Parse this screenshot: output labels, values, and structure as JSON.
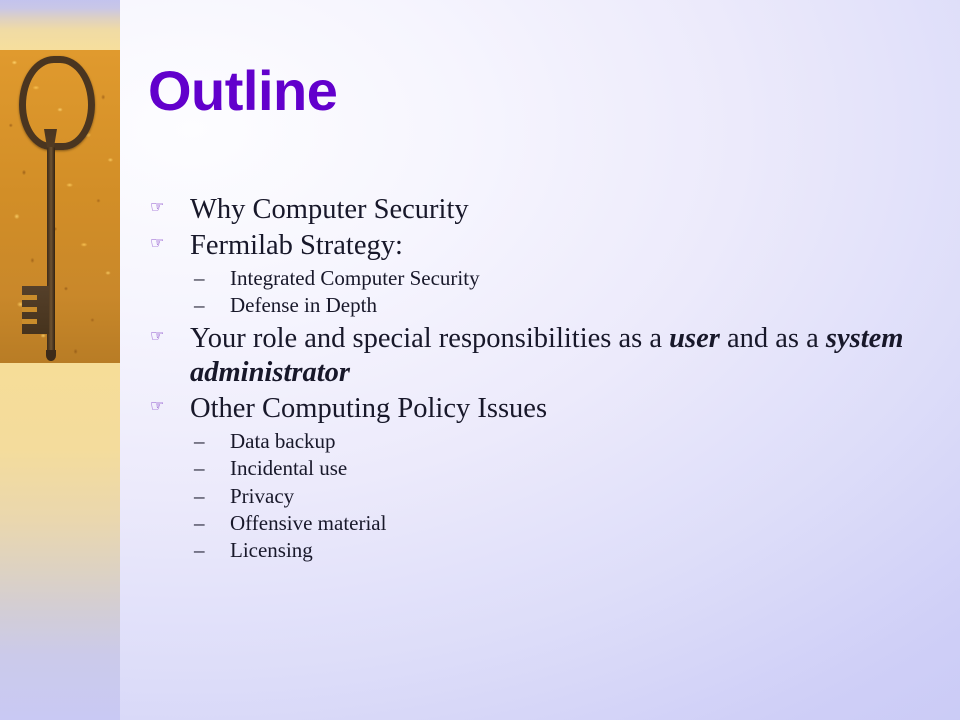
{
  "slide": {
    "title": "Outline",
    "title_color": "#6200cc",
    "body_text_color": "#18182a",
    "background_color": "#cfcff7",
    "accent_color": "#6b1fbd"
  },
  "markers": {
    "level1": "☞",
    "level2": "–"
  },
  "sidebar": {
    "image_name": "antique-key-on-sand-photo",
    "band_top_color": "#c3c3ee",
    "sand_color": "#d9902a",
    "key_color": "#4a3520",
    "band_bottom_color": "#f6dd98"
  },
  "bullets": [
    {
      "level": 1,
      "name": "bullet-why-computer-security",
      "text": "Why Computer Security"
    },
    {
      "level": 1,
      "name": "bullet-fermilab-strategy",
      "text": "Fermilab Strategy:"
    },
    {
      "level": 2,
      "name": "bullet-integrated-computer-security",
      "text": "Integrated Computer Security"
    },
    {
      "level": 2,
      "name": "bullet-defense-in-depth",
      "text": "Defense in Depth"
    },
    {
      "level": 1,
      "name": "bullet-your-role-and-responsibilities",
      "rich": true,
      "parts": [
        {
          "text": "Your role and special responsibilities as a ",
          "style": "normal"
        },
        {
          "text": "user",
          "style": "bold-italic"
        },
        {
          "text": " and as a ",
          "style": "normal"
        },
        {
          "text": "system administrator",
          "style": "bold-italic"
        }
      ]
    },
    {
      "level": 1,
      "name": "bullet-other-computing-policy-issues",
      "text": "Other Computing Policy Issues"
    },
    {
      "level": 2,
      "name": "bullet-data-backup",
      "text": "Data backup"
    },
    {
      "level": 2,
      "name": "bullet-incidental-use",
      "text": "Incidental use"
    },
    {
      "level": 2,
      "name": "bullet-privacy",
      "text": "Privacy"
    },
    {
      "level": 2,
      "name": "bullet-offensive-material",
      "text": "Offensive material"
    },
    {
      "level": 2,
      "name": "bullet-licensing",
      "text": "Licensing"
    }
  ]
}
